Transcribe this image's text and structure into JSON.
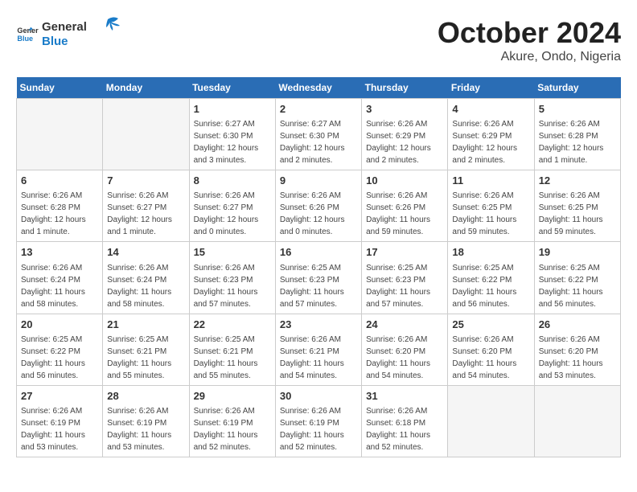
{
  "header": {
    "logo_line1": "General",
    "logo_line2": "Blue",
    "month_year": "October 2024",
    "location": "Akure, Ondo, Nigeria"
  },
  "weekdays": [
    "Sunday",
    "Monday",
    "Tuesday",
    "Wednesday",
    "Thursday",
    "Friday",
    "Saturday"
  ],
  "weeks": [
    [
      {
        "day": "",
        "empty": true
      },
      {
        "day": "",
        "empty": true
      },
      {
        "day": "1",
        "sunrise": "6:27 AM",
        "sunset": "6:30 PM",
        "daylight": "12 hours and 3 minutes."
      },
      {
        "day": "2",
        "sunrise": "6:27 AM",
        "sunset": "6:30 PM",
        "daylight": "12 hours and 2 minutes."
      },
      {
        "day": "3",
        "sunrise": "6:26 AM",
        "sunset": "6:29 PM",
        "daylight": "12 hours and 2 minutes."
      },
      {
        "day": "4",
        "sunrise": "6:26 AM",
        "sunset": "6:29 PM",
        "daylight": "12 hours and 2 minutes."
      },
      {
        "day": "5",
        "sunrise": "6:26 AM",
        "sunset": "6:28 PM",
        "daylight": "12 hours and 1 minute."
      }
    ],
    [
      {
        "day": "6",
        "sunrise": "6:26 AM",
        "sunset": "6:28 PM",
        "daylight": "12 hours and 1 minute."
      },
      {
        "day": "7",
        "sunrise": "6:26 AM",
        "sunset": "6:27 PM",
        "daylight": "12 hours and 1 minute."
      },
      {
        "day": "8",
        "sunrise": "6:26 AM",
        "sunset": "6:27 PM",
        "daylight": "12 hours and 0 minutes."
      },
      {
        "day": "9",
        "sunrise": "6:26 AM",
        "sunset": "6:26 PM",
        "daylight": "12 hours and 0 minutes."
      },
      {
        "day": "10",
        "sunrise": "6:26 AM",
        "sunset": "6:26 PM",
        "daylight": "11 hours and 59 minutes."
      },
      {
        "day": "11",
        "sunrise": "6:26 AM",
        "sunset": "6:25 PM",
        "daylight": "11 hours and 59 minutes."
      },
      {
        "day": "12",
        "sunrise": "6:26 AM",
        "sunset": "6:25 PM",
        "daylight": "11 hours and 59 minutes."
      }
    ],
    [
      {
        "day": "13",
        "sunrise": "6:26 AM",
        "sunset": "6:24 PM",
        "daylight": "11 hours and 58 minutes."
      },
      {
        "day": "14",
        "sunrise": "6:26 AM",
        "sunset": "6:24 PM",
        "daylight": "11 hours and 58 minutes."
      },
      {
        "day": "15",
        "sunrise": "6:26 AM",
        "sunset": "6:23 PM",
        "daylight": "11 hours and 57 minutes."
      },
      {
        "day": "16",
        "sunrise": "6:25 AM",
        "sunset": "6:23 PM",
        "daylight": "11 hours and 57 minutes."
      },
      {
        "day": "17",
        "sunrise": "6:25 AM",
        "sunset": "6:23 PM",
        "daylight": "11 hours and 57 minutes."
      },
      {
        "day": "18",
        "sunrise": "6:25 AM",
        "sunset": "6:22 PM",
        "daylight": "11 hours and 56 minutes."
      },
      {
        "day": "19",
        "sunrise": "6:25 AM",
        "sunset": "6:22 PM",
        "daylight": "11 hours and 56 minutes."
      }
    ],
    [
      {
        "day": "20",
        "sunrise": "6:25 AM",
        "sunset": "6:22 PM",
        "daylight": "11 hours and 56 minutes."
      },
      {
        "day": "21",
        "sunrise": "6:25 AM",
        "sunset": "6:21 PM",
        "daylight": "11 hours and 55 minutes."
      },
      {
        "day": "22",
        "sunrise": "6:25 AM",
        "sunset": "6:21 PM",
        "daylight": "11 hours and 55 minutes."
      },
      {
        "day": "23",
        "sunrise": "6:26 AM",
        "sunset": "6:21 PM",
        "daylight": "11 hours and 54 minutes."
      },
      {
        "day": "24",
        "sunrise": "6:26 AM",
        "sunset": "6:20 PM",
        "daylight": "11 hours and 54 minutes."
      },
      {
        "day": "25",
        "sunrise": "6:26 AM",
        "sunset": "6:20 PM",
        "daylight": "11 hours and 54 minutes."
      },
      {
        "day": "26",
        "sunrise": "6:26 AM",
        "sunset": "6:20 PM",
        "daylight": "11 hours and 53 minutes."
      }
    ],
    [
      {
        "day": "27",
        "sunrise": "6:26 AM",
        "sunset": "6:19 PM",
        "daylight": "11 hours and 53 minutes."
      },
      {
        "day": "28",
        "sunrise": "6:26 AM",
        "sunset": "6:19 PM",
        "daylight": "11 hours and 53 minutes."
      },
      {
        "day": "29",
        "sunrise": "6:26 AM",
        "sunset": "6:19 PM",
        "daylight": "11 hours and 52 minutes."
      },
      {
        "day": "30",
        "sunrise": "6:26 AM",
        "sunset": "6:19 PM",
        "daylight": "11 hours and 52 minutes."
      },
      {
        "day": "31",
        "sunrise": "6:26 AM",
        "sunset": "6:18 PM",
        "daylight": "11 hours and 52 minutes."
      },
      {
        "day": "",
        "empty": true
      },
      {
        "day": "",
        "empty": true
      }
    ]
  ]
}
